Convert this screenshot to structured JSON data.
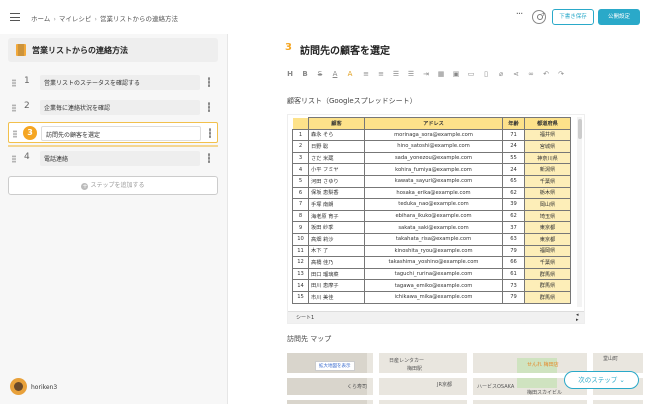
{
  "breadcrumb": [
    "ホーム",
    "マイレシピ",
    "営業リストからの連絡方法"
  ],
  "header": {
    "draft_label": "下書き保存",
    "publish_label": "公開設定",
    "accent_color": "#2aa9c9"
  },
  "sidebar": {
    "title": "営業リストからの連絡方法",
    "steps": [
      {
        "num": "1",
        "label": "営業リストのステータスを確認する"
      },
      {
        "num": "2",
        "label": "企業毎に連絡状況を確認"
      },
      {
        "num": "3",
        "label": "訪問先の顧客を選定",
        "active": true
      },
      {
        "num": "4",
        "label": "電話連絡"
      }
    ],
    "add_step_label": "ステップを追加する",
    "username": "horiken3"
  },
  "main": {
    "step_num": "3",
    "step_title": "訪問先の顧客を選定",
    "section1_label": "顧客リスト（Googleスプレッドシート）",
    "section2_label": "訪問先 マップ",
    "next_label": "次のステップ"
  },
  "sheet": {
    "headers": [
      "顧客",
      "アドレス",
      "年齢",
      "都道府県"
    ],
    "rows": [
      [
        "1",
        "森永 そら",
        "morinaga_sora@example.com",
        "71",
        "福井県"
      ],
      [
        "2",
        "日野 聡",
        "hino_satoshi@example.com",
        "24",
        "宮城県"
      ],
      [
        "3",
        "さだ 米蔵",
        "sada_yonezou@example.com",
        "55",
        "神奈川県"
      ],
      [
        "4",
        "小平 フミヤ",
        "kohira_fumiya@example.com",
        "24",
        "新潟県"
      ],
      [
        "5",
        "河田 さゆり",
        "kawata_sayuri@example.com",
        "65",
        "千葉県"
      ],
      [
        "6",
        "保坂 恵梨香",
        "hosaka_erika@example.com",
        "62",
        "栃木県"
      ],
      [
        "7",
        "手塚 南朗",
        "teduka_nao@example.com",
        "39",
        "岡山県"
      ],
      [
        "8",
        "海老原 育子",
        "ebihara_ikuko@example.com",
        "62",
        "埼玉県"
      ],
      [
        "9",
        "坂田 紗季",
        "sakata_saki@example.com",
        "37",
        "東京都"
      ],
      [
        "10",
        "高畑 莉沙",
        "takahata_risa@example.com",
        "63",
        "東京都"
      ],
      [
        "11",
        "木下 了",
        "kinoshita_ryou@example.com",
        "79",
        "福岡県"
      ],
      [
        "12",
        "高橋 佳乃",
        "takashima_yoshino@example.com",
        "66",
        "千葉県"
      ],
      [
        "13",
        "田口 瑠璃菜",
        "taguchi_rurina@example.com",
        "61",
        "群馬県"
      ],
      [
        "14",
        "田川 恵摩子",
        "tagawa_emiko@example.com",
        "73",
        "群馬県"
      ],
      [
        "15",
        "市川 美佳",
        "ichikawa_mika@example.com",
        "79",
        "群馬県"
      ]
    ],
    "tab_label": "シート1"
  },
  "map": {
    "link_label": "拡大地図を表示",
    "labels": [
      "日産レンタカー",
      "梅田駅",
      "JR京都",
      "くら寿司",
      "ハービスOSAKA",
      "せんれ 梅田店",
      "梅田スカイビル",
      "堂山町"
    ]
  }
}
